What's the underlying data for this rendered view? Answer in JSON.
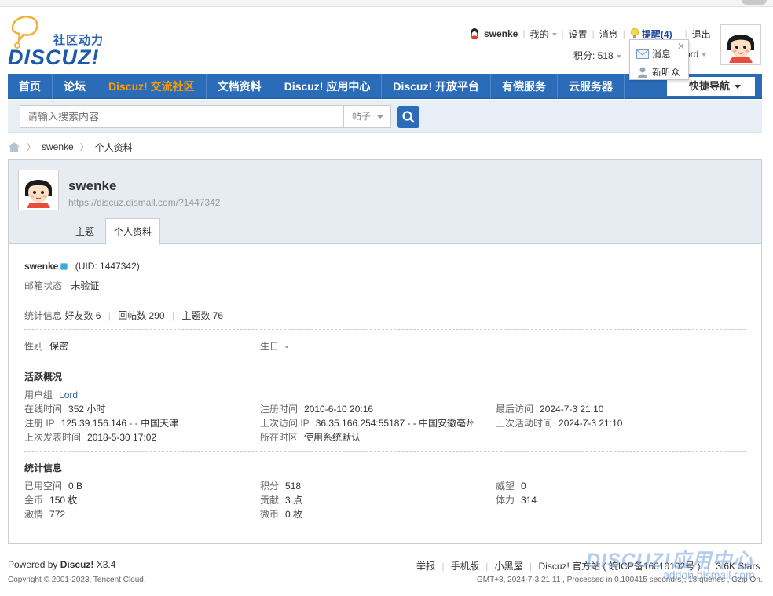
{
  "header": {
    "logo_slogan": "社区动力",
    "logo_text": "DISCUZ!"
  },
  "userbar": {
    "username": "swenke",
    "my": "我的",
    "settings": "设置",
    "messages": "消息",
    "remind": "提醒(4)",
    "logout": "退出",
    "credits": "积分: 518",
    "group_partial": "ord"
  },
  "popup": {
    "item1": "消息",
    "item2": "新听众"
  },
  "nav": {
    "items": [
      "首页",
      "论坛",
      "Discuz! 交流社区",
      "文档资料",
      "Discuz! 应用中心",
      "Discuz! 开放平台",
      "有偿服务",
      "云服务器"
    ],
    "quick_nav": "快捷导航"
  },
  "search": {
    "placeholder": "请输入搜索内容",
    "type": "帖子"
  },
  "breadcrumb": {
    "user": "swenke",
    "page": "个人资料"
  },
  "profile": {
    "name": "swenke",
    "url": "https://discuz.dismall.com/?1447342",
    "tabs": [
      "主题",
      "个人资料"
    ],
    "uid_text": "(UID: 1447342)",
    "email_label": "邮箱状态",
    "email_value": "未验证",
    "stats_label": "统计信息",
    "friends": "好友数 6",
    "replies": "回帖数 290",
    "threads": "主题数 76",
    "gender_label": "性别",
    "gender_value": "保密",
    "birthday_label": "生日",
    "birthday_value": "-",
    "activity_title": "活跃概况",
    "usergroup_label": "用户组",
    "usergroup_value": "Lord",
    "online_label": "在线时间",
    "online_value": "352 小时",
    "regtime_label": "注册时间",
    "regtime_value": "2010-6-10 20:16",
    "lastvisit_label": "最后访问",
    "lastvisit_value": "2024-7-3 21:10",
    "regip_label": "注册 IP",
    "regip_value": "125.39.156.146 - - 中国天津",
    "lastip_label": "上次访问 IP",
    "lastip_value": "36.35.166.254:55187 - - 中国安徽亳州",
    "lastactive_label": "上次活动时间",
    "lastactive_value": "2024-7-3 21:10",
    "lastpost_label": "上次发表时间",
    "lastpost_value": "2018-5-30 17:02",
    "timezone_label": "所在时区",
    "timezone_value": "使用系统默认",
    "statsinfo_title": "统计信息",
    "space_label": "已用空间",
    "space_value": "0 B",
    "credits_label": "积分",
    "credits_value": "518",
    "prestige_label": "威望",
    "prestige_value": "0",
    "gold_label": "金币",
    "gold_value": "150 枚",
    "contrib_label": "贡献",
    "contrib_value": "3 点",
    "stamina_label": "体力",
    "stamina_value": "314",
    "passion_label": "激情",
    "passion_value": "772",
    "weicoin_label": "微币",
    "weicoin_value": "0 枚"
  },
  "footer": {
    "powered_prefix": "Powered by",
    "powered_brand": "Discuz!",
    "version": "X3.4",
    "copyright": "Copyright © 2001-2023, Tencent Cloud.",
    "links": [
      "举报",
      "手机版",
      "小黑屋",
      "Discuz! 官方站 ( 皖ICP备16010102号 )",
      "3.6K Stars"
    ],
    "info": "GMT+8, 2024-7-3 21:11 , Processed in 0.100415 second(s), 18 queries , Gzip On."
  },
  "watermark": {
    "text1": "DISCUZ!应用中心",
    "text2": "addon.dismall.com"
  },
  "colors": {
    "nav_bg": "#2b6cb8",
    "nav_active": "#ff9c00",
    "link_blue": "#336699"
  }
}
